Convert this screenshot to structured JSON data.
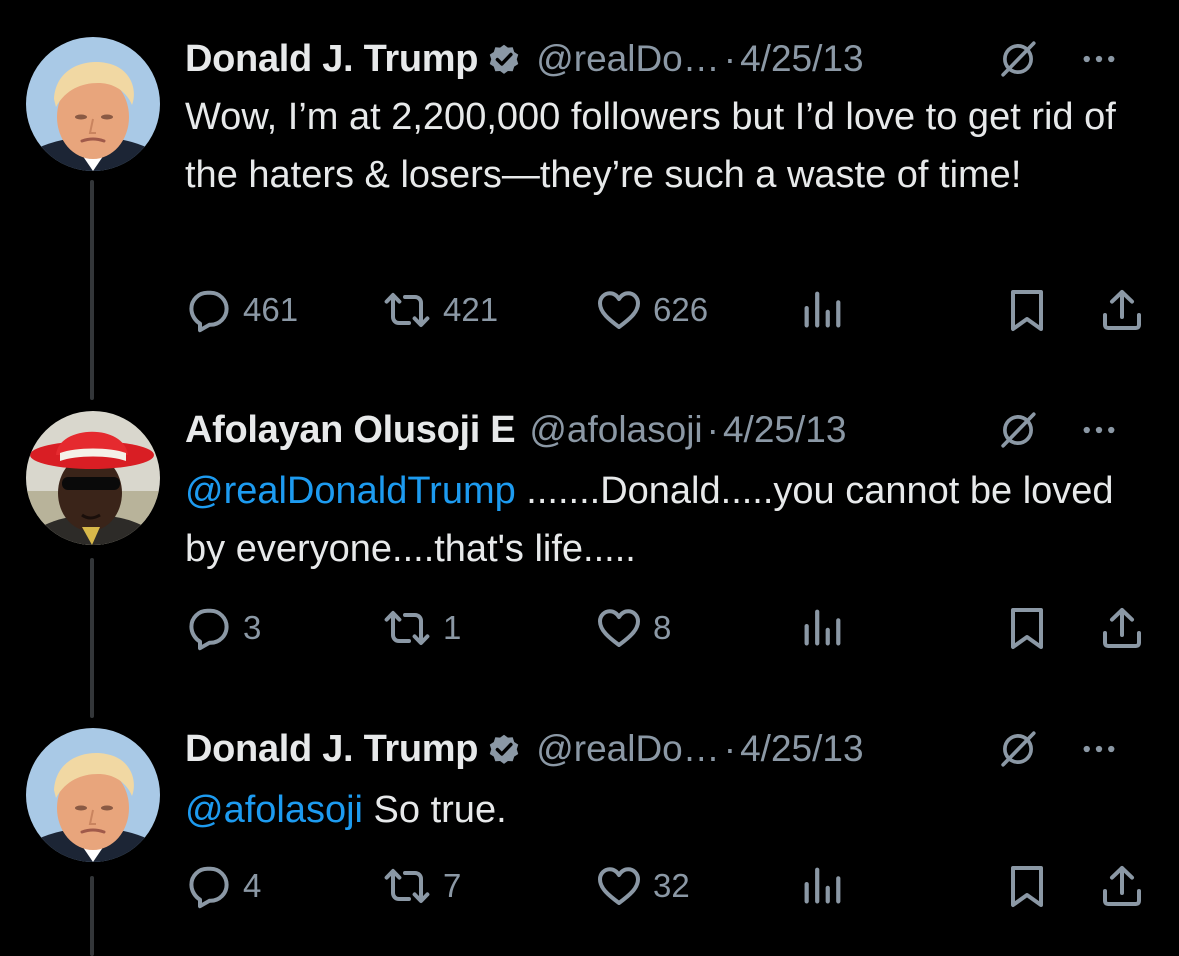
{
  "tweets": [
    {
      "name": "Donald J. Trump",
      "verified": true,
      "handle": "@realDo…",
      "dot": "·",
      "date": "4/25/13",
      "mention": "",
      "text": "Wow, I’m at 2,200,000  followers but I’d love to get rid of the haters & losers—they’re such a waste of time!",
      "replies": "461",
      "retweets": "421",
      "likes": "626"
    },
    {
      "name": "Afolayan Olusoji E",
      "verified": false,
      "handle": "@afolasoji",
      "dot": "·",
      "date": "4/25/13",
      "mention": "@realDonaldTrump",
      "text": " .......Donald.....you cannot be loved by everyone....that's life.....",
      "replies": "3",
      "retweets": "1",
      "likes": "8"
    },
    {
      "name": "Donald J. Trump",
      "verified": true,
      "handle": "@realDo…",
      "dot": "·",
      "date": "4/25/13",
      "mention": "@afolasoji",
      "text": " So true.",
      "replies": "4",
      "retweets": "7",
      "likes": "32"
    }
  ],
  "icons": {
    "reply": "reply-icon",
    "retweet": "retweet-icon",
    "like": "heart-icon",
    "views": "views-icon",
    "bookmark": "bookmark-icon",
    "share": "share-icon",
    "grok": "grok-icon",
    "more": "more-icon",
    "verified": "verified-badge-icon"
  },
  "colors": {
    "background": "#000000",
    "text": "#e7e9ea",
    "secondary": "#8b98a5",
    "link": "#1d9bf0",
    "thread_line": "#333639"
  }
}
